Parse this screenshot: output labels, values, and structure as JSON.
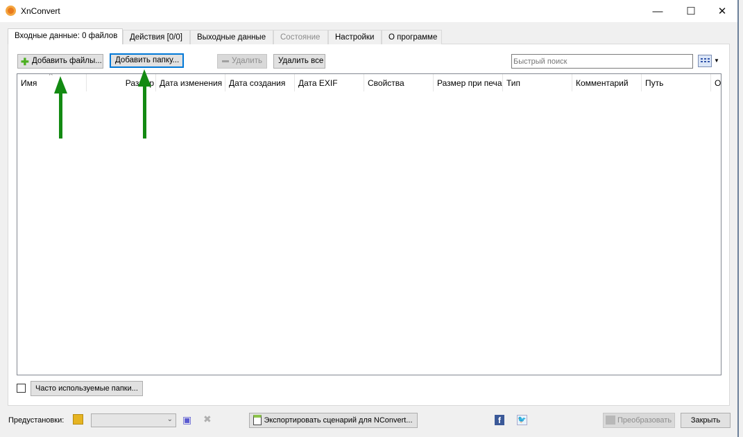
{
  "window": {
    "title": "XnConvert",
    "minimize": "—",
    "maximize": "☐",
    "close": "✕"
  },
  "tabs": [
    {
      "label": "Входные данные: 0 файлов",
      "active": true
    },
    {
      "label": "Действия [0/0]"
    },
    {
      "label": "Выходные данные"
    },
    {
      "label": "Состояние",
      "disabled": true
    },
    {
      "label": "Настройки"
    },
    {
      "label": "О программе"
    }
  ],
  "toolbar": {
    "add_files": "Добавить файлы...",
    "add_folder": "Добавить папку...",
    "remove": "Удалить",
    "remove_all": "Удалить все",
    "search_placeholder": "Быстрый поиск"
  },
  "columns": [
    "Имя",
    "Размер",
    "Дата изменения",
    "Дата создания",
    "Дата EXIF",
    "Свойства",
    "Размер при печа",
    "Тип",
    "Комментарий",
    "Путь",
    "О"
  ],
  "footer": {
    "frequent_folders": "Часто используемые папки...",
    "presets_label": "Предустановки:",
    "preset_value": "",
    "export": "Экспортировать сценарий для NConvert...",
    "convert": "Преобразовать",
    "close": "Закрыть"
  },
  "colors": {
    "accent": "#0078d7",
    "annotation_arrow": "#138a12"
  }
}
